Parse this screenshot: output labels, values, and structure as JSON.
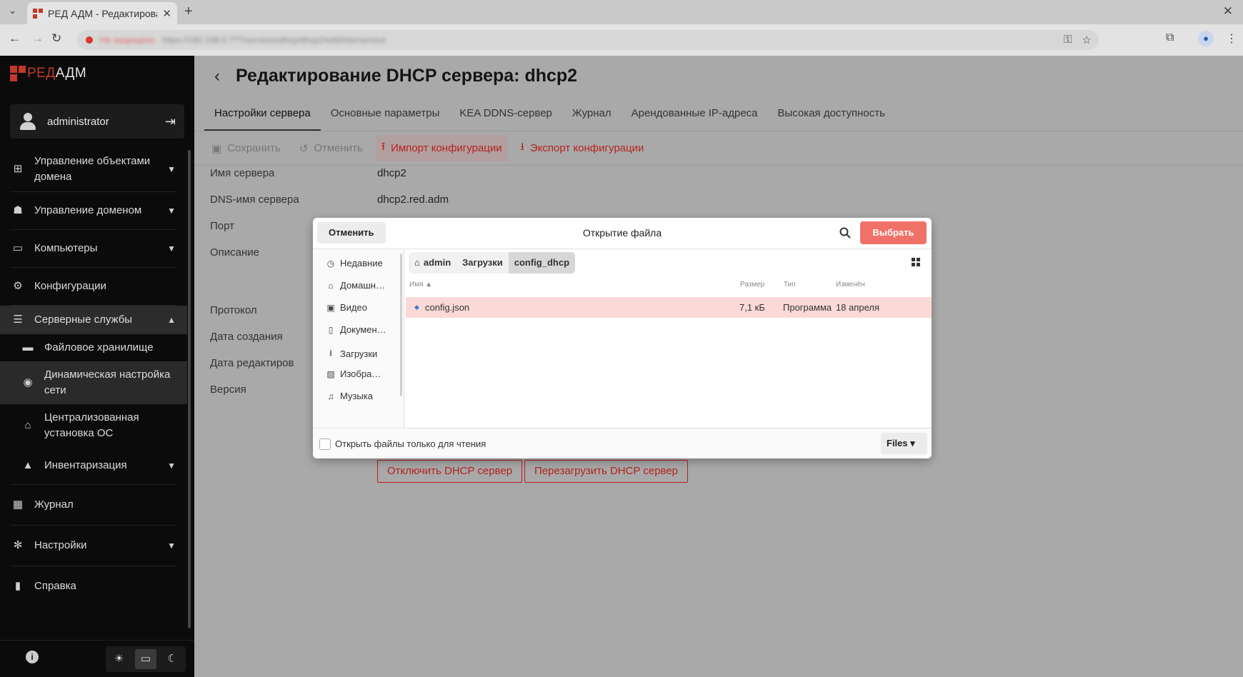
{
  "browser": {
    "tab_title": "РЕД АДМ - Редактирова",
    "url_warning": "Не защищено",
    "url": "https://192.168.0.???/services/dhcp/dhcp2/edit/interservice"
  },
  "app": {
    "logo_red": "РЕД",
    "logo_rest": "АДМ",
    "user": "administrator"
  },
  "sidebar": {
    "items": [
      {
        "label": "Управление объектами",
        "label2": "домена"
      },
      {
        "label": "Управление доменом"
      },
      {
        "label": "Компьютеры"
      },
      {
        "label": "Конфигурации"
      },
      {
        "label": "Серверные службы"
      },
      {
        "label": "Файловое хранилище"
      },
      {
        "label": "Динамическая настройка",
        "label2": "сети"
      },
      {
        "label": "Централизованная",
        "label2": "установка ОС"
      },
      {
        "label": "Инвентаризация"
      },
      {
        "label": "Журнал"
      },
      {
        "label": "Настройки"
      },
      {
        "label": "Справка"
      }
    ]
  },
  "page": {
    "title": "Редактирование DHCP сервера: dhcp2",
    "tabs": [
      "Настройки сервера",
      "Основные параметры",
      "KEA DDNS-сервер",
      "Журнал",
      "Арендованные IP-адреса",
      "Высокая доступность"
    ],
    "toolbar": {
      "save": "Сохранить",
      "cancel": "Отменить",
      "import": "Импорт конфигурации",
      "export": "Экспорт конфигурации"
    },
    "fields": {
      "server_name_label": "Имя сервера",
      "server_name_value": "dhcp2",
      "dns_label": "DNS-имя сервера",
      "dns_value": "dhcp2.red.adm",
      "port_label": "Порт",
      "description_label": "Описание",
      "protocol_label": "Протокол",
      "created_label": "Дата создания",
      "modified_label": "Дата редактирования",
      "version_label": "Версия"
    },
    "buttons": {
      "disable": "Отключить DHCP сервер",
      "restart": "Перезагрузить DHCP сервер"
    }
  },
  "dialog": {
    "title": "Открытие файла",
    "cancel": "Отменить",
    "select": "Выбрать",
    "places": [
      "Недавние",
      "Домашн…",
      "Видео",
      "Докумен…",
      "Загрузки",
      "Изобра…",
      "Музыка"
    ],
    "breadcrumbs": [
      "admin",
      "Загрузки",
      "config_dhcp"
    ],
    "columns": {
      "name": "Имя",
      "size": "Размер",
      "type": "Тип",
      "modified": "Изменён"
    },
    "file": {
      "name": "config.json",
      "size": "7,1 кБ",
      "type": "Программа",
      "modified": "18 апреля"
    },
    "readonly_label": "Открыть файлы только для чтения",
    "filter": "Files"
  },
  "colors": {
    "accent_red": "#b4231f",
    "select_button": "#f07167",
    "selected_row": "#fbd9d7",
    "sidebar_bg": "#0b0b0b"
  }
}
